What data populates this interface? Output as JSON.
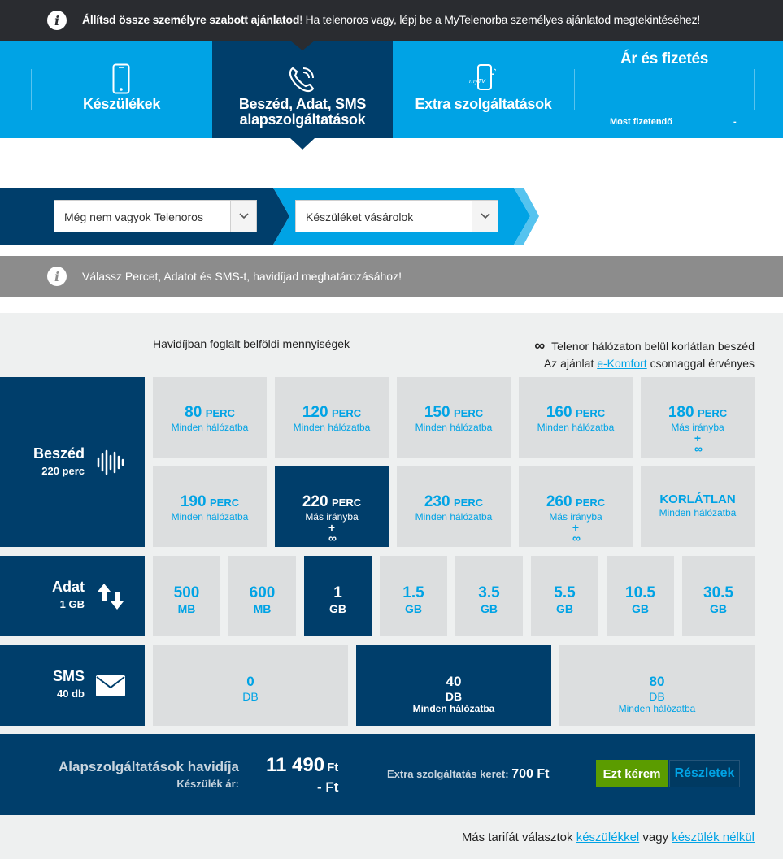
{
  "topbar": {
    "icon": "info-icon",
    "bold": "Állítsd össze személyre szabott ajánlatod",
    "rest": "! Ha telenoros vagy, lépj be a MyTelenorba személyes ajánlatod megtekintéséhez!"
  },
  "nav": {
    "tabs": [
      {
        "label": "Készülékek",
        "icon": "phone-icon"
      },
      {
        "label1": "Beszéd, Adat, SMS",
        "label2": "alapszolgáltatások",
        "icon": "phone-call-icon"
      },
      {
        "label": "Extra szolgáltatások",
        "icon": "mytv-phone-icon",
        "icon_text": "myTV"
      },
      {
        "label": "Ár és fizetés",
        "pay_label": "Most fizetendő",
        "pay_value": "-"
      }
    ]
  },
  "selectors": [
    {
      "value": "Még nem vagyok Telenoros"
    },
    {
      "value": "Készüléket vásárolok"
    }
  ],
  "graybar": {
    "text": "Válassz Percet, Adatot és SMS-t, havidíjad meghatározásához!"
  },
  "main": {
    "subtitle_left": "Havidíjban foglalt belföldi mennyiségek",
    "right_line1": "Telenor hálózaton belül korlátlan beszéd",
    "right_line2_pre": "Az ajánlat ",
    "right_line2_link": "e-Komfort",
    "right_line2_post": " csomaggal érvényes",
    "inf_symbol": "∞"
  },
  "speech": {
    "name": "Beszéd",
    "value": "220 perc",
    "icon": "soundwave-icon",
    "tiles_row1": [
      {
        "num": "80",
        "unit": "PERC",
        "sub": "Minden hálózatba"
      },
      {
        "num": "120",
        "unit": "PERC",
        "sub": "Minden hálózatba"
      },
      {
        "num": "150",
        "unit": "PERC",
        "sub": "Minden hálózatba"
      },
      {
        "num": "160",
        "unit": "PERC",
        "sub": "Minden hálózatba"
      },
      {
        "num": "180",
        "unit": "PERC",
        "sub": "Más irányba",
        "plus": "+",
        "inf": "∞"
      }
    ],
    "tiles_row2": [
      {
        "num": "190",
        "unit": "PERC",
        "sub": "Minden hálózatba"
      },
      {
        "num": "220",
        "unit": "PERC",
        "sub": "Más irányba",
        "plus": "+",
        "inf": "∞"
      },
      {
        "num": "230",
        "unit": "PERC",
        "sub": "Minden hálózatba"
      },
      {
        "num": "260",
        "unit": "PERC",
        "sub": "Más irányba",
        "plus": "+",
        "inf": "∞"
      },
      {
        "num": "KORLÁTLAN",
        "sub": "Minden hálózatba"
      }
    ]
  },
  "data": {
    "name": "Adat",
    "value": "1 GB",
    "icon": "up-down-arrows-icon",
    "tiles": [
      {
        "num": "500",
        "unit": "MB"
      },
      {
        "num": "600",
        "unit": "MB"
      },
      {
        "num": "1",
        "unit": "GB"
      },
      {
        "num": "1.5",
        "unit": "GB"
      },
      {
        "num": "3.5",
        "unit": "GB"
      },
      {
        "num": "5.5",
        "unit": "GB"
      },
      {
        "num": "10.5",
        "unit": "GB"
      },
      {
        "num": "30.5",
        "unit": "GB"
      }
    ]
  },
  "sms": {
    "name": "SMS",
    "value": "40 db",
    "icon": "envelope-icon",
    "tiles": [
      {
        "num": "0",
        "unit": "DB"
      },
      {
        "num": "40",
        "unit": "DB",
        "sub": "Minden hálózatba"
      },
      {
        "num": "80",
        "unit": "DB",
        "sub": "Minden hálózatba"
      }
    ]
  },
  "summary": {
    "title": "Alapszolgáltatások havidíja",
    "device_label": "Készülék ár:",
    "price": "11 490",
    "price_unit": "Ft",
    "device_price": "- Ft",
    "extra_label": "Extra szolgáltatás keret:",
    "extra_value": "700 Ft",
    "btn_ok": "Ezt kérem",
    "btn_details": "Részletek"
  },
  "footer": {
    "pre": "Más tarifát választok ",
    "link1": "készülékkel",
    "mid": " vagy ",
    "link2": "készülék nélkül"
  },
  "colors": {
    "dark_blue": "#003e6b",
    "brand_blue": "#00a3e5",
    "green": "#5b9c00",
    "tile_gray": "#dcdedf"
  }
}
